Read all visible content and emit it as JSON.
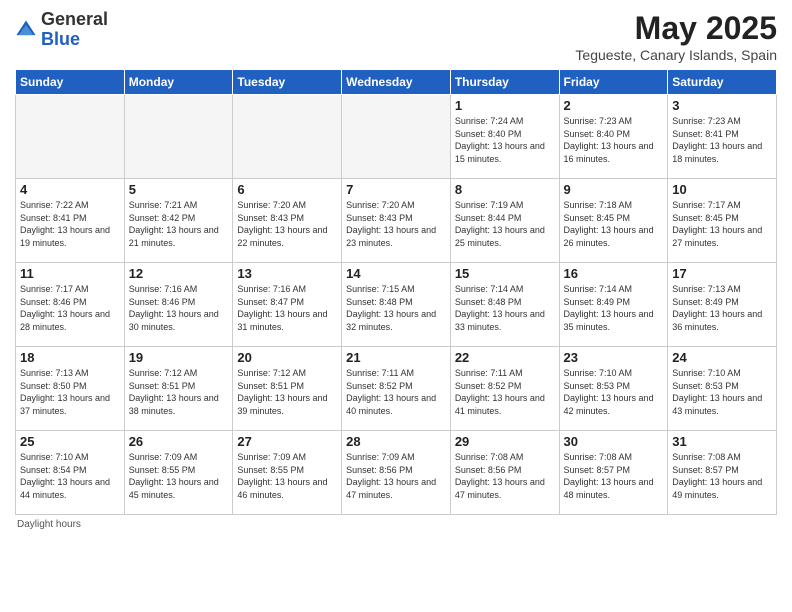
{
  "logo": {
    "general": "General",
    "blue": "Blue"
  },
  "title": "May 2025",
  "subtitle": "Tegueste, Canary Islands, Spain",
  "days_of_week": [
    "Sunday",
    "Monday",
    "Tuesday",
    "Wednesday",
    "Thursday",
    "Friday",
    "Saturday"
  ],
  "footer": "Daylight hours",
  "weeks": [
    [
      {
        "num": "",
        "sunrise": "",
        "sunset": "",
        "daylight": ""
      },
      {
        "num": "",
        "sunrise": "",
        "sunset": "",
        "daylight": ""
      },
      {
        "num": "",
        "sunrise": "",
        "sunset": "",
        "daylight": ""
      },
      {
        "num": "",
        "sunrise": "",
        "sunset": "",
        "daylight": ""
      },
      {
        "num": "1",
        "sunrise": "7:24 AM",
        "sunset": "8:40 PM",
        "daylight": "13 hours and 15 minutes."
      },
      {
        "num": "2",
        "sunrise": "7:23 AM",
        "sunset": "8:40 PM",
        "daylight": "13 hours and 16 minutes."
      },
      {
        "num": "3",
        "sunrise": "7:23 AM",
        "sunset": "8:41 PM",
        "daylight": "13 hours and 18 minutes."
      }
    ],
    [
      {
        "num": "4",
        "sunrise": "7:22 AM",
        "sunset": "8:41 PM",
        "daylight": "13 hours and 19 minutes."
      },
      {
        "num": "5",
        "sunrise": "7:21 AM",
        "sunset": "8:42 PM",
        "daylight": "13 hours and 21 minutes."
      },
      {
        "num": "6",
        "sunrise": "7:20 AM",
        "sunset": "8:43 PM",
        "daylight": "13 hours and 22 minutes."
      },
      {
        "num": "7",
        "sunrise": "7:20 AM",
        "sunset": "8:43 PM",
        "daylight": "13 hours and 23 minutes."
      },
      {
        "num": "8",
        "sunrise": "7:19 AM",
        "sunset": "8:44 PM",
        "daylight": "13 hours and 25 minutes."
      },
      {
        "num": "9",
        "sunrise": "7:18 AM",
        "sunset": "8:45 PM",
        "daylight": "13 hours and 26 minutes."
      },
      {
        "num": "10",
        "sunrise": "7:17 AM",
        "sunset": "8:45 PM",
        "daylight": "13 hours and 27 minutes."
      }
    ],
    [
      {
        "num": "11",
        "sunrise": "7:17 AM",
        "sunset": "8:46 PM",
        "daylight": "13 hours and 28 minutes."
      },
      {
        "num": "12",
        "sunrise": "7:16 AM",
        "sunset": "8:46 PM",
        "daylight": "13 hours and 30 minutes."
      },
      {
        "num": "13",
        "sunrise": "7:16 AM",
        "sunset": "8:47 PM",
        "daylight": "13 hours and 31 minutes."
      },
      {
        "num": "14",
        "sunrise": "7:15 AM",
        "sunset": "8:48 PM",
        "daylight": "13 hours and 32 minutes."
      },
      {
        "num": "15",
        "sunrise": "7:14 AM",
        "sunset": "8:48 PM",
        "daylight": "13 hours and 33 minutes."
      },
      {
        "num": "16",
        "sunrise": "7:14 AM",
        "sunset": "8:49 PM",
        "daylight": "13 hours and 35 minutes."
      },
      {
        "num": "17",
        "sunrise": "7:13 AM",
        "sunset": "8:49 PM",
        "daylight": "13 hours and 36 minutes."
      }
    ],
    [
      {
        "num": "18",
        "sunrise": "7:13 AM",
        "sunset": "8:50 PM",
        "daylight": "13 hours and 37 minutes."
      },
      {
        "num": "19",
        "sunrise": "7:12 AM",
        "sunset": "8:51 PM",
        "daylight": "13 hours and 38 minutes."
      },
      {
        "num": "20",
        "sunrise": "7:12 AM",
        "sunset": "8:51 PM",
        "daylight": "13 hours and 39 minutes."
      },
      {
        "num": "21",
        "sunrise": "7:11 AM",
        "sunset": "8:52 PM",
        "daylight": "13 hours and 40 minutes."
      },
      {
        "num": "22",
        "sunrise": "7:11 AM",
        "sunset": "8:52 PM",
        "daylight": "13 hours and 41 minutes."
      },
      {
        "num": "23",
        "sunrise": "7:10 AM",
        "sunset": "8:53 PM",
        "daylight": "13 hours and 42 minutes."
      },
      {
        "num": "24",
        "sunrise": "7:10 AM",
        "sunset": "8:53 PM",
        "daylight": "13 hours and 43 minutes."
      }
    ],
    [
      {
        "num": "25",
        "sunrise": "7:10 AM",
        "sunset": "8:54 PM",
        "daylight": "13 hours and 44 minutes."
      },
      {
        "num": "26",
        "sunrise": "7:09 AM",
        "sunset": "8:55 PM",
        "daylight": "13 hours and 45 minutes."
      },
      {
        "num": "27",
        "sunrise": "7:09 AM",
        "sunset": "8:55 PM",
        "daylight": "13 hours and 46 minutes."
      },
      {
        "num": "28",
        "sunrise": "7:09 AM",
        "sunset": "8:56 PM",
        "daylight": "13 hours and 47 minutes."
      },
      {
        "num": "29",
        "sunrise": "7:08 AM",
        "sunset": "8:56 PM",
        "daylight": "13 hours and 47 minutes."
      },
      {
        "num": "30",
        "sunrise": "7:08 AM",
        "sunset": "8:57 PM",
        "daylight": "13 hours and 48 minutes."
      },
      {
        "num": "31",
        "sunrise": "7:08 AM",
        "sunset": "8:57 PM",
        "daylight": "13 hours and 49 minutes."
      }
    ]
  ]
}
